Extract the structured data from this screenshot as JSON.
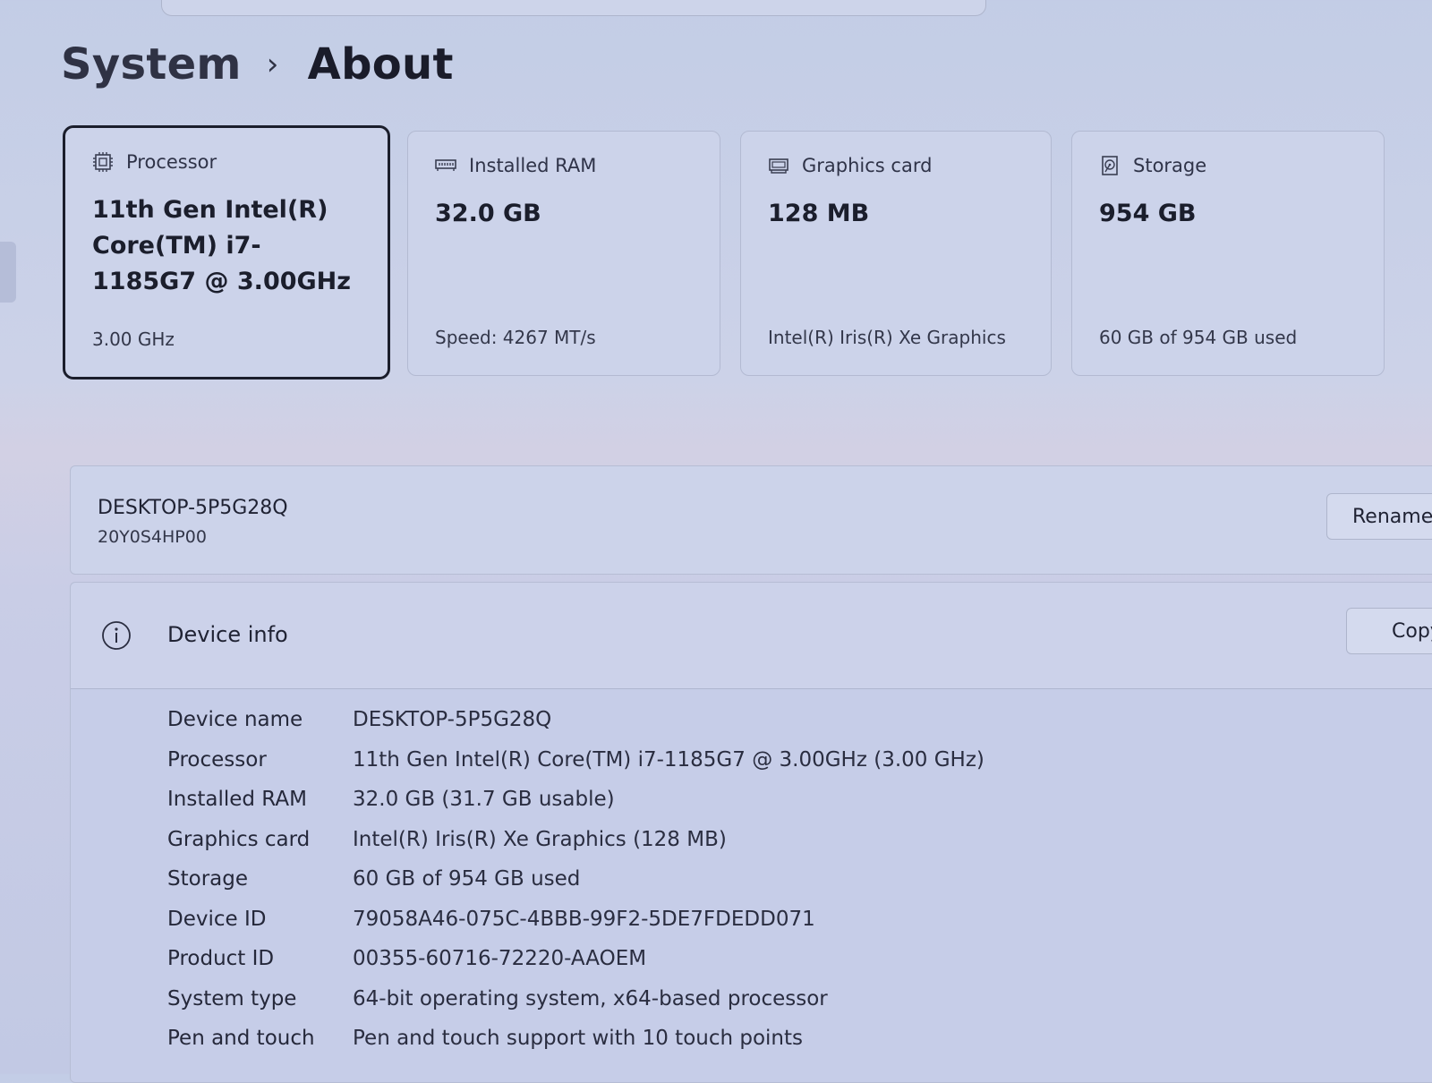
{
  "breadcrumb": {
    "parent": "System",
    "separator": "›",
    "current": "About"
  },
  "cards": [
    {
      "icon": "processor-chip-icon",
      "title": "Processor",
      "value": "11th Gen Intel(R) Core(TM) i7-1185G7 @ 3.00GHz",
      "sub": "3.00 GHz",
      "selected": true
    },
    {
      "icon": "ram-module-icon",
      "title": "Installed RAM",
      "value": "32.0 GB",
      "sub": "Speed: 4267 MT/s",
      "selected": false
    },
    {
      "icon": "graphics-card-icon",
      "title": "Graphics card",
      "value": "128 MB",
      "sub": "Intel(R) Iris(R) Xe Graphics",
      "selected": false
    },
    {
      "icon": "storage-drive-icon",
      "title": "Storage",
      "value": "954 GB",
      "sub": "60 GB of 954 GB used",
      "selected": false
    }
  ],
  "device": {
    "name": "DESKTOP-5P5G28Q",
    "model": "20Y0S4HP00",
    "rename_label": "Rename"
  },
  "device_info": {
    "icon": "info-circle-icon",
    "title": "Device info",
    "copy_label": "Copy",
    "rows": [
      {
        "label": "Device name",
        "value": "DESKTOP-5P5G28Q"
      },
      {
        "label": "Processor",
        "value": "11th Gen Intel(R) Core(TM) i7-1185G7 @ 3.00GHz (3.00 GHz)"
      },
      {
        "label": "Installed RAM",
        "value": "32.0 GB (31.7 GB usable)"
      },
      {
        "label": "Graphics card",
        "value": "Intel(R) Iris(R) Xe Graphics (128 MB)"
      },
      {
        "label": "Storage",
        "value": "60 GB of 954 GB used"
      },
      {
        "label": "Device ID",
        "value": "79058A46-075C-4BBB-99F2-5DE7FDEDD071"
      },
      {
        "label": "Product ID",
        "value": "00355-60716-72220-AAOEM"
      },
      {
        "label": "System type",
        "value": "64-bit operating system, x64-based processor"
      },
      {
        "label": "Pen and touch",
        "value": "Pen and touch support with 10 touch points"
      }
    ]
  }
}
